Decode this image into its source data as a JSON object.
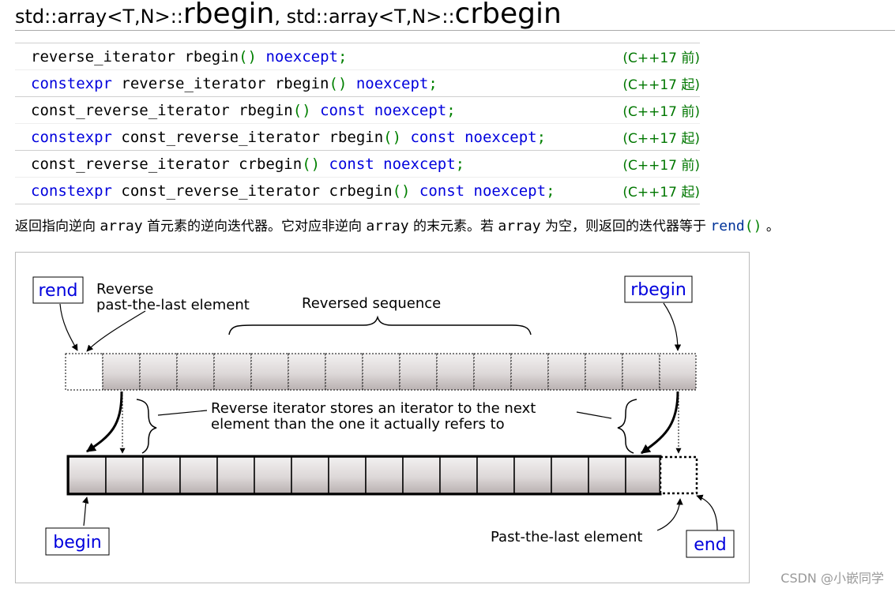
{
  "title": {
    "part1": "std::array<T,N>::",
    "part2": "rbegin",
    "part3": ", ",
    "part4": "std::array<T,N>::",
    "part5": "crbegin"
  },
  "declarations": [
    {
      "constexpr": "",
      "ret": "reverse_iterator ",
      "name": "rbegin",
      "parens": "()",
      "qual": " noexcept",
      "semi": ";",
      "version": "(C++17 前)"
    },
    {
      "constexpr": "constexpr ",
      "ret": "reverse_iterator ",
      "name": "rbegin",
      "parens": "()",
      "qual": " noexcept",
      "semi": ";",
      "version": "(C++17 起)"
    },
    {
      "constexpr": "",
      "ret": "const_reverse_iterator ",
      "name": "rbegin",
      "parens": "()",
      "qual": " const noexcept",
      "semi": ";",
      "version": "(C++17 前)"
    },
    {
      "constexpr": "constexpr ",
      "ret": "const_reverse_iterator  ",
      "name": "rbegin",
      "parens": "()",
      "qual": " const noexcept",
      "semi": ";",
      "version": "(C++17 起)"
    },
    {
      "constexpr": "",
      "ret": "const_reverse_iterator ",
      "name": "crbegin",
      "parens": "()",
      "qual": " const noexcept",
      "semi": ";",
      "version": "(C++17 前)"
    },
    {
      "constexpr": "constexpr ",
      "ret": "const_reverse_iterator ",
      "name": "crbegin",
      "parens": "()",
      "qual": " const noexcept",
      "semi": ";",
      "version": "(C++17 起)"
    }
  ],
  "description": {
    "t1": "返回指向逆向 ",
    "c1": "array",
    "t2": " 首元素的逆向迭代器。它对应非逆向 ",
    "c2": "array",
    "t3": " 的末元素。若 ",
    "c3": "array",
    "t4": " 为空，则返回的迭代器等于 ",
    "link_name": "rend",
    "link_parens": "()",
    "t5": " 。"
  },
  "diagram": {
    "rend_label": "rend",
    "rend_note_line1": "Reverse",
    "rend_note_line2": "past-the-last element",
    "reversed_sequence": "Reversed sequence",
    "rbegin_label": "rbegin",
    "middle_note_line1": "Reverse iterator stores an iterator to the next",
    "middle_note_line2": "element than the one it actually refers to",
    "begin_label": "begin",
    "past_last": "Past-the-last element",
    "end_label": "end",
    "label_color": "#0000dd"
  },
  "watermark": "CSDN @小嵌同学"
}
